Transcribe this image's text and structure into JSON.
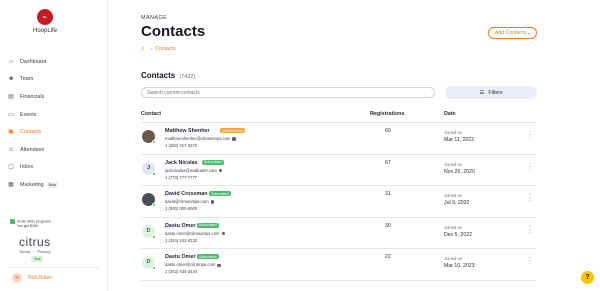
{
  "brand": {
    "logo_text": "HoopLife",
    "name": "HoopLife",
    "accent": "#f07b2a",
    "logo_color": "#c41b24"
  },
  "sidebar": {
    "items": [
      {
        "label": "Dashboard",
        "icon": "home-icon"
      },
      {
        "label": "Team",
        "icon": "team-icon"
      },
      {
        "label": "Financials",
        "icon": "financials-icon"
      },
      {
        "label": "Events",
        "icon": "events-icon"
      },
      {
        "label": "Contacts",
        "icon": "contacts-icon",
        "active": true
      },
      {
        "label": "Attendees",
        "icon": "attendees-icon"
      },
      {
        "label": "Inbox",
        "icon": "inbox-icon"
      },
      {
        "label": "Marketing",
        "icon": "marketing-icon",
        "badge": "Beta"
      }
    ],
    "invite": {
      "line1": "Invite other programs",
      "line2": "You get $250"
    },
    "citrus": "citrus",
    "terms": "Terms",
    "privacy": "Privacy",
    "test_badge": "Test",
    "user": {
      "initial": "N",
      "name": "Nick Bolen"
    }
  },
  "header": {
    "section": "MANAGE",
    "title": "Contacts",
    "add_button": "Add Contacts",
    "breadcrumb": [
      "Contacts"
    ]
  },
  "contacts": {
    "title": "Contacts",
    "count": "(7422)",
    "search_placeholder": "Search current contacts",
    "filters_label": "Filters",
    "columns": {
      "contact": "Contact",
      "registrations": "Registrations",
      "date": "Date"
    },
    "rows": [
      {
        "initial": "",
        "avatar_bg": "#6b5a4a",
        "name": "Matthew Shenher",
        "status": "Unsubscribed",
        "status_type": "unsub",
        "email": "matthew.shenher@citrusamps.com",
        "phone": "1 (250) 317-2572",
        "registrations": "60",
        "joined": "Joined on",
        "date": "Mar 11, 2022"
      },
      {
        "initial": "J",
        "avatar_bg": "#dfe6ef",
        "name": "Jack Nicolas",
        "status": "Subscribed",
        "status_type": "sub",
        "email": "jacknicolas@mailinator.com",
        "phone": "1 (773) 777-7777",
        "registrations": "67",
        "joined": "Joined on",
        "date": "Nov 26, 2020"
      },
      {
        "initial": "",
        "avatar_bg": "#4a4f57",
        "name": "David Crossman",
        "status": "Subscribed",
        "status_type": "sub",
        "email": "david@citrusamps.com",
        "phone": "1 (000) 000-0000",
        "registrations": "31",
        "joined": "Joined on",
        "date": "Jul 9, 2020"
      },
      {
        "initial": "D",
        "avatar_bg": "#dff3e1",
        "name": "Dastu Omer",
        "status": "Subscribed",
        "status_type": "sub",
        "email": "dastu.omer@citrusamps.com",
        "phone": "1 (324) 242-4232",
        "registrations": "30",
        "joined": "Joined on",
        "date": "Dec 5, 2022"
      },
      {
        "initial": "D",
        "avatar_bg": "#dff3e1",
        "name": "Dastu Omer",
        "status": "Subscribed",
        "status_type": "sub",
        "email": "dastu.omer@citrampa.com",
        "phone": "1 (343) 434-3434",
        "registrations": "22",
        "joined": "Joined on",
        "date": "Mar 10, 2023"
      }
    ]
  },
  "help_label": "?"
}
